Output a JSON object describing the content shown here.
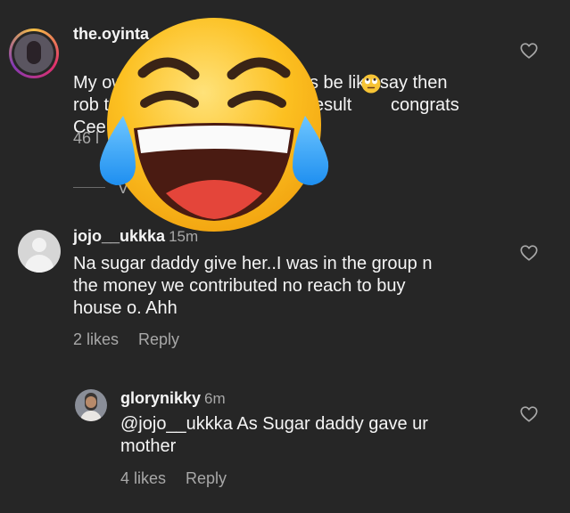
{
  "comments": [
    {
      "username": "the.oyinta",
      "time": "",
      "text_line1": "My ow",
      "text_line1b": "s be like say then",
      "text_line2": "rob t",
      "text_line2b": "esult",
      "text_line2c": "congrats",
      "text_line3": "Cee",
      "likes": "46 l",
      "view_replies": "V"
    },
    {
      "username": "jojo__ukkka",
      "time": "15m",
      "text": "Na sugar daddy give her..I was in the group n\nthe money we contributed no reach to buy\nhouse o. Ahh",
      "likes": "2 likes",
      "reply": "Reply"
    },
    {
      "username": "glorynikky",
      "time": "6m",
      "text": "@jojo__ukkka As Sugar daddy gave ur\nmother",
      "likes": "4 likes",
      "reply": "Reply"
    }
  ],
  "icons": {
    "heart": "heart-outline-icon",
    "emoji_small": "face-with-rolling-eyes-emoji",
    "emoji_large": "face-with-tears-of-joy-emoji"
  }
}
